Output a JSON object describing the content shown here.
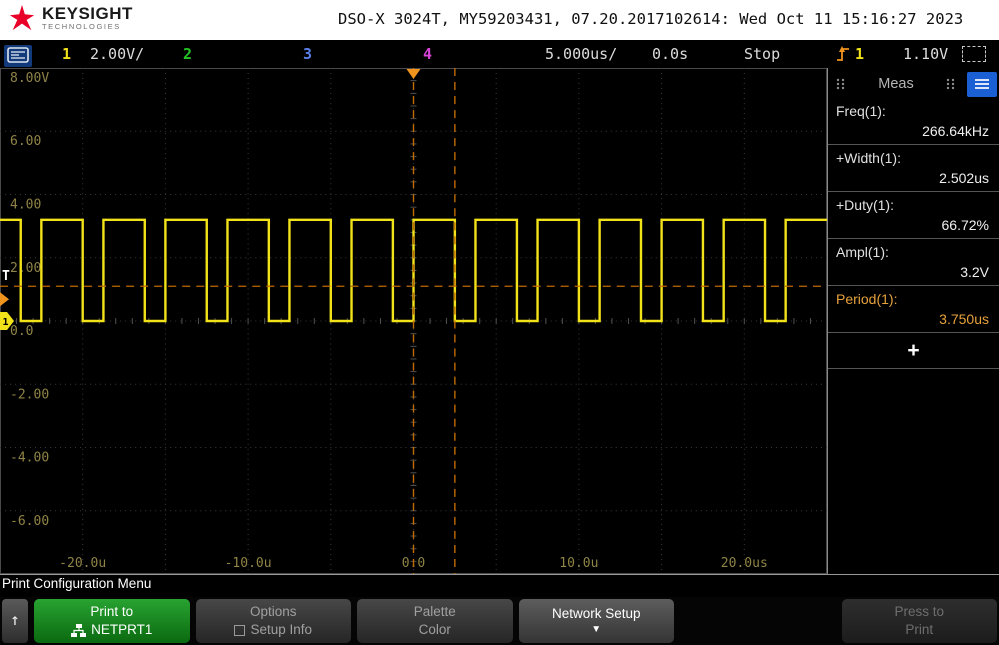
{
  "colors": {
    "accent_blue": "#1a5fd4",
    "ch1_yellow": "#f2e219",
    "ch2_green": "#23c423",
    "ch3_blue": "#5a7fe8",
    "ch4_magenta": "#d843d8",
    "cursor_orange": "#c06a00",
    "trigger_orange": "#f0941e",
    "label_olive": "#8f8446",
    "meas_orange": "#e8a23c",
    "softkey_green": "#17871c"
  },
  "header": {
    "brand": "KEYSIGHT",
    "brand_sub": "TECHNOLOGIES",
    "title": "DSO-X 3024T, MY59203431, 07.20.2017102614: Wed Oct 11 15:16:27 2023"
  },
  "statusbar": {
    "ch1_num": "1",
    "ch1_scale": "2.00V/",
    "ch2_num": "2",
    "ch3_num": "3",
    "ch4_num": "4",
    "timebase": "5.000us/",
    "delay": "0.0s",
    "acq_state": "Stop",
    "trig_source": "1",
    "trig_level": "1.10V"
  },
  "scope": {
    "v_labels": [
      "8.00V",
      "6.00",
      "4.00",
      "2.00",
      "0.0",
      "-2.00",
      "-4.00",
      "-6.00"
    ],
    "t_labels": [
      "-20.0u",
      "-10.0u",
      "0.0",
      "10.0u",
      "20.0us"
    ],
    "trigger_marker": "T",
    "ch1_marker": "1",
    "waveform": {
      "type": "square",
      "channel": 1,
      "t_min_us": -25,
      "t_max_us": 25,
      "v_max": 8,
      "v_min": -8,
      "volts_per_div": 2,
      "time_per_div_us": 5,
      "high_v": 3.2,
      "low_v": 0,
      "period_us": 3.75,
      "high_width_us": 2.502,
      "trigger_t_us": 0,
      "trigger_level_v": 1.1
    }
  },
  "meas_panel": {
    "title": "Meas",
    "items": [
      {
        "label": "Freq(1):",
        "value": "266.64kHz",
        "highlight": false
      },
      {
        "label": "+Width(1):",
        "value": "2.502us",
        "highlight": false
      },
      {
        "label": "+Duty(1):",
        "value": "66.72%",
        "highlight": false
      },
      {
        "label": "Ampl(1):",
        "value": "3.2V",
        "highlight": false
      },
      {
        "label": "Period(1):",
        "value": "3.750us",
        "highlight": true
      }
    ],
    "add_label": "+"
  },
  "bottom": {
    "menu_title": "Print Configuration Menu",
    "back_icon": "↑",
    "softkeys": [
      {
        "line1": "Print to",
        "line2": "NETPRT1",
        "style": "green"
      },
      {
        "line1": "Options",
        "line2": "Setup Info",
        "style": "dim"
      },
      {
        "line1": "Palette",
        "line2": "Color",
        "style": "dim"
      },
      {
        "line1": "Network Setup",
        "line2": "▼",
        "style": "active"
      },
      {
        "style": "empty"
      },
      {
        "line1": "Press to",
        "line2": "Print",
        "style": "disabled"
      }
    ]
  }
}
